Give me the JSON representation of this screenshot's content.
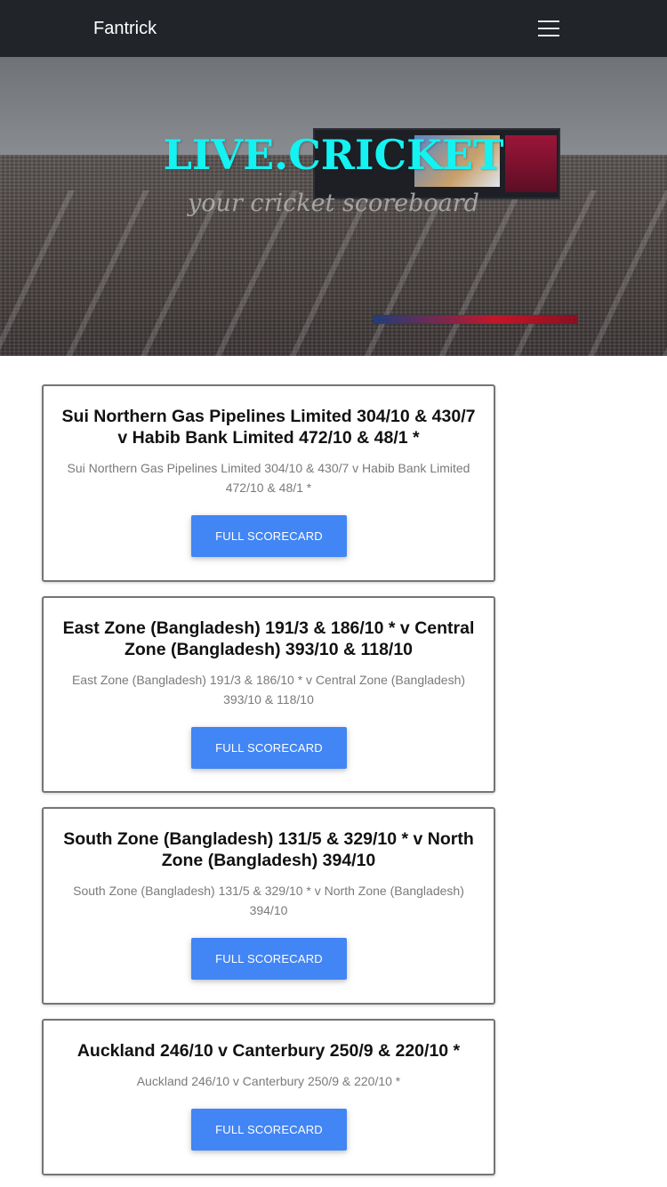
{
  "navbar": {
    "brand": "Fantrick",
    "menu_icon": "hamburger-menu-icon"
  },
  "hero": {
    "title": "LIVE.CRICKET",
    "subtitle": "your cricket scoreboard"
  },
  "matches": [
    {
      "title": "Sui Northern Gas Pipelines Limited 304/10 & 430/7 v Habib Bank Limited 472/10 & 48/1 *",
      "description": "Sui Northern Gas Pipelines Limited 304/10 & 430/7 v Habib Bank Limited 472/10 & 48/1 *",
      "button_label": "FULL SCORECARD"
    },
    {
      "title": "East Zone (Bangladesh) 191/3 & 186/10 * v Central Zone (Bangladesh) 393/10 & 118/10",
      "description": "East Zone (Bangladesh) 191/3 & 186/10 * v Central Zone (Bangladesh) 393/10 & 118/10",
      "button_label": "FULL SCORECARD"
    },
    {
      "title": "South Zone (Bangladesh) 131/5 & 329/10 * v North Zone (Bangladesh) 394/10",
      "description": "South Zone (Bangladesh) 131/5 & 329/10 * v North Zone (Bangladesh) 394/10",
      "button_label": "FULL SCORECARD"
    },
    {
      "title": "Auckland 246/10 v Canterbury 250/9 & 220/10 *",
      "description": "Auckland 246/10 v Canterbury 250/9 & 220/10 *",
      "button_label": "FULL SCORECARD"
    }
  ],
  "colors": {
    "navbar_bg": "#212529",
    "hero_title": "#14f2f2",
    "button_bg": "#4285f4"
  }
}
